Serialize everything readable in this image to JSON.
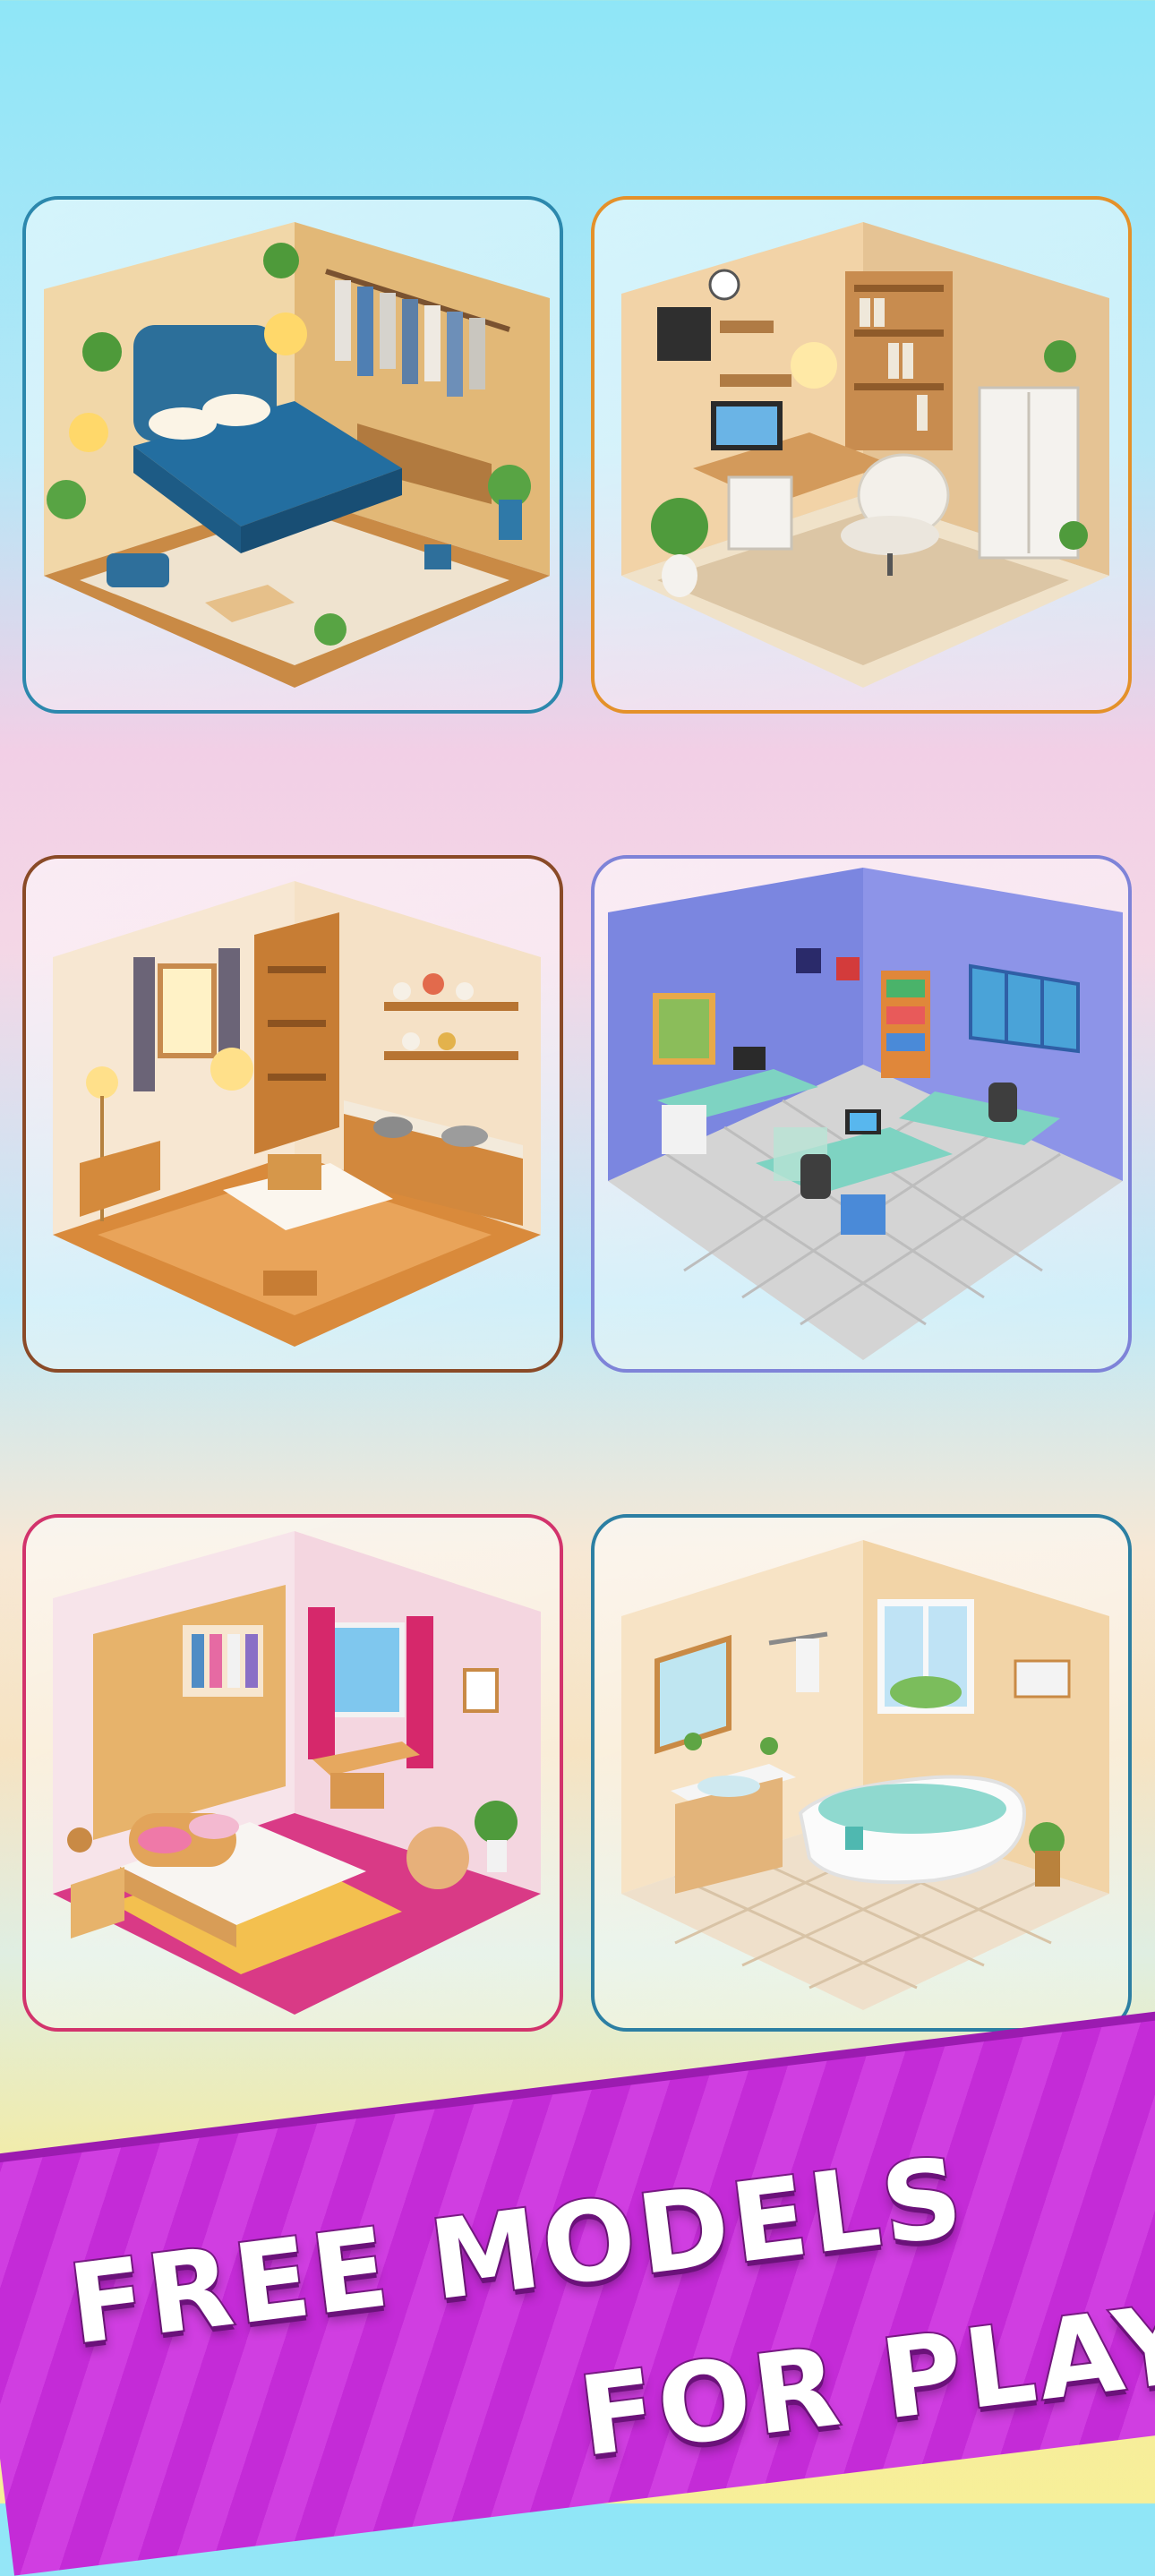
{
  "banner": {
    "line1": "FREE MODELS",
    "line2": "FOR PLAY",
    "color": "#c42bd7"
  },
  "cards": [
    {
      "room": "blue-bedroom-with-wardrobe",
      "border": "#2c88ad"
    },
    {
      "room": "home-office-with-bookshelves",
      "border": "#e4912a"
    },
    {
      "room": "wooden-kitchen-dining",
      "border": "#8a4a27"
    },
    {
      "room": "blue-open-office",
      "border": "#7e83d8"
    },
    {
      "room": "pink-bedroom",
      "border": "#d2336c"
    },
    {
      "room": "beige-bathroom",
      "border": "#2c7fa3"
    }
  ]
}
